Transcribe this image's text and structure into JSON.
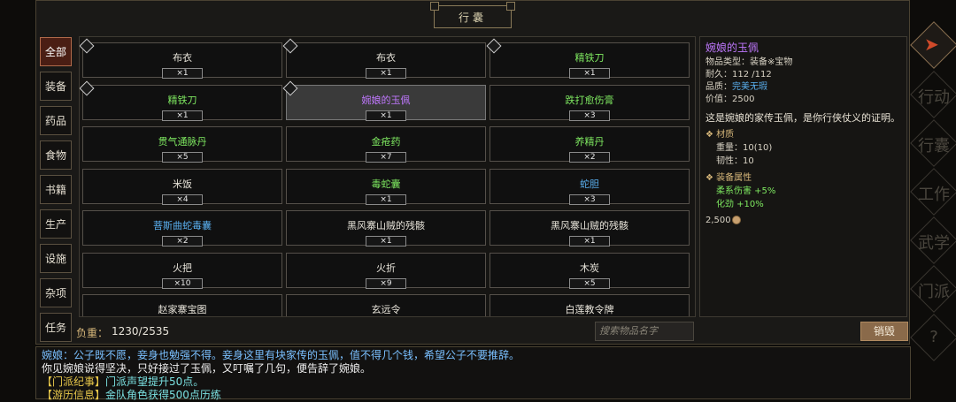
{
  "window_title": "行囊",
  "categories": [
    {
      "label": "全部",
      "active": true
    },
    {
      "label": "装备",
      "active": false
    },
    {
      "label": "药品",
      "active": false
    },
    {
      "label": "食物",
      "active": false
    },
    {
      "label": "书籍",
      "active": false
    },
    {
      "label": "生产",
      "active": false
    },
    {
      "label": "设施",
      "active": false
    },
    {
      "label": "杂项",
      "active": false
    },
    {
      "label": "任务",
      "active": false
    }
  ],
  "items": [
    {
      "name": "布衣",
      "qty": "×1",
      "color": "white",
      "tag": true
    },
    {
      "name": "布衣",
      "qty": "×1",
      "color": "white",
      "tag": true
    },
    {
      "name": "精铁刀",
      "qty": "×1",
      "color": "green",
      "tag": true
    },
    {
      "name": "精铁刀",
      "qty": "×1",
      "color": "green",
      "tag": true
    },
    {
      "name": "婉娘的玉佩",
      "qty": "×1",
      "color": "purple",
      "tag": true,
      "selected": true
    },
    {
      "name": "跌打愈伤膏",
      "qty": "×3",
      "color": "green"
    },
    {
      "name": "贯气通脉丹",
      "qty": "×5",
      "color": "green"
    },
    {
      "name": "金疮药",
      "qty": "×7",
      "color": "green"
    },
    {
      "name": "养精丹",
      "qty": "×2",
      "color": "green"
    },
    {
      "name": "米饭",
      "qty": "×4",
      "color": "white"
    },
    {
      "name": "毒蛇囊",
      "qty": "×1",
      "color": "green"
    },
    {
      "name": "蛇胆",
      "qty": "×3",
      "color": "blue"
    },
    {
      "name": "菩斯曲蛇毒囊",
      "qty": "×2",
      "color": "blue"
    },
    {
      "name": "黑风寨山贼的残骸",
      "qty": "×1",
      "color": "white"
    },
    {
      "name": "黑风寨山贼的残骸",
      "qty": "×1",
      "color": "white"
    },
    {
      "name": "火把",
      "qty": "×10",
      "color": "white"
    },
    {
      "name": "火折",
      "qty": "×9",
      "color": "white"
    },
    {
      "name": "木炭",
      "qty": "×5",
      "color": "white"
    },
    {
      "name": "赵家寨宝图",
      "qty": "",
      "color": "white"
    },
    {
      "name": "玄远令",
      "qty": "",
      "color": "white"
    },
    {
      "name": "白莲教令牌",
      "qty": "",
      "color": "white"
    }
  ],
  "detail": {
    "name": "婉娘的玉佩",
    "type": "物品类型：装备※宝物",
    "durability": "耐久：112 /112",
    "quality_label": "品质：",
    "quality_value": "完美无瑕",
    "price": "价值：2500",
    "description": "这是婉娘的家传玉佩，是你行侠仗义的证明。",
    "material_header": "❖ 材质",
    "weight": "重量：10(10)",
    "toughness": "韧性：10",
    "attr_header": "❖ 装备属性",
    "attr1": "柔系伤害 +5%",
    "attr2": "化劲 +10%",
    "coins": "2,500"
  },
  "footer": {
    "weight_label": "负重：",
    "weight_value": "1230/2535",
    "search_placeholder": "搜索物品名字",
    "destroy_label": "销毁"
  },
  "log": {
    "line1": "婉娘：公子既不愿，妾身也勉强不得。妾身这里有块家传的玉佩，值不得几个钱，希望公子不要推辞。",
    "line2": "你见婉娘说得坚决，只好接过了玉佩，又叮嘱了几句，便告辞了婉娘。",
    "line3_tag": "【门派纪事】",
    "line3_text": "门派声望提升50点。",
    "line4_tag": "【游历信息】",
    "line4_text": "金队角色获得500点历练"
  },
  "side_labels": [
    "行动",
    "行囊",
    "工作",
    "武学",
    "门派",
    "?"
  ],
  "colors": {
    "white": "#e8e4da",
    "green": "#7ee860",
    "purple": "#c078ff",
    "blue": "#5ab0f0",
    "accent": "#d04a2a"
  }
}
